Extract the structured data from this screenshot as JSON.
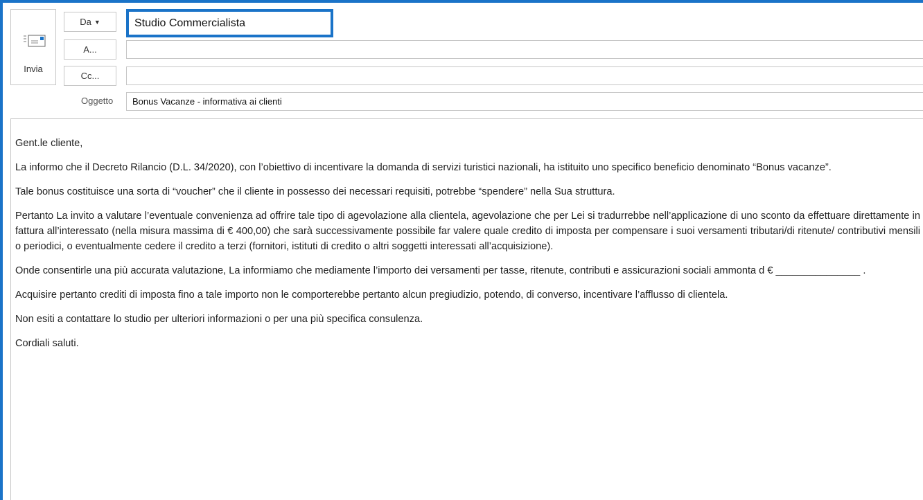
{
  "header": {
    "send_label": "Invia",
    "from_button": "Da",
    "from_value": "Studio Commercialista",
    "to_button": "A...",
    "to_value": "",
    "cc_button": "Cc...",
    "cc_value": "",
    "subject_label": "Oggetto",
    "subject_value": "Bonus Vacanze - informativa ai clienti"
  },
  "message": {
    "greeting": "Gent.le cliente,",
    "paragraphs": [
      "La informo che il Decreto Rilancio (D.L. 34/2020), con l’obiettivo di incentivare la domanda di servizi turistici nazionali, ha istituito uno specifico beneficio denominato “Bonus vacanze”.",
      "Tale bonus costituisce una sorta di “voucher” che il cliente in possesso dei necessari requisiti, potrebbe “spendere” nella Sua struttura.",
      "Pertanto La invito a valutare l’eventuale convenienza ad offrire tale tipo di agevolazione alla clientela, agevolazione che per Lei si tradurrebbe nell’applicazione di uno sconto da effettuare direttamente in fattura all’interessato (nella misura massima di € 400,00) che sarà successivamente possibile far valere quale credito di imposta per compensare i suoi versamenti tributari/di ritenute/ contributivi mensili o periodici, o eventualmente cedere il credito a terzi (fornitori, istituti di credito o altri soggetti interessati all’acquisizione).",
      "Onde consentirle una più accurata valutazione, La informiamo che mediamente l’importo dei versamenti per tasse, ritenute, contributi e assicurazioni sociali ammonta d € _______________ .",
      "Acquisire pertanto crediti di imposta fino a tale importo non le comporterebbe pertanto alcun pregiudizio, potendo, di converso, incentivare l’afflusso di clientela.",
      "Non esiti a contattare lo studio per ulteriori informazioni o per una più specifica consulenza."
    ],
    "closing": "Cordiali saluti."
  },
  "icons": {
    "send": "envelope-send-icon",
    "from_dropdown": "caret-down-icon"
  },
  "colors": {
    "accent": "#1a73c8",
    "border": "#c6c6c6"
  }
}
